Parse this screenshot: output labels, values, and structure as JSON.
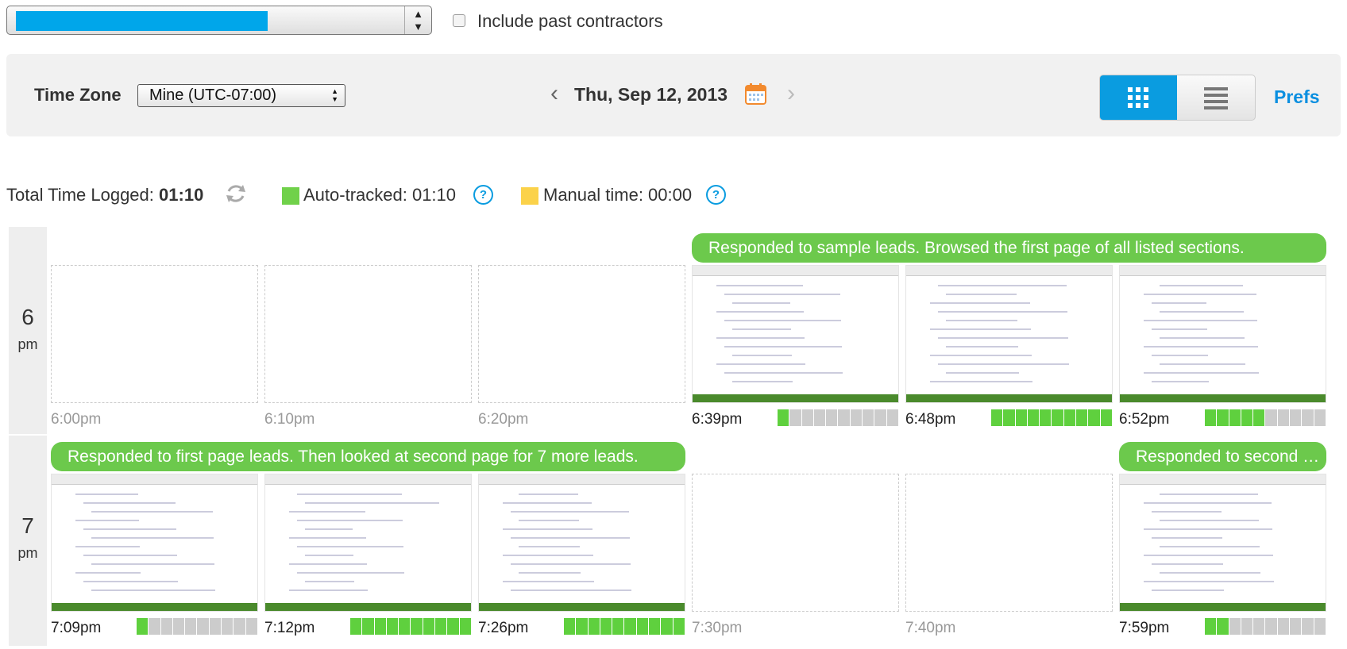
{
  "filter": {
    "past_contractors_label": "Include past contractors",
    "past_contractors_checked": false
  },
  "controls": {
    "timezone_label": "Time Zone",
    "timezone_value": "Mine (UTC-07:00)",
    "date": "Thu, Sep 12, 2013",
    "prefs_label": "Prefs",
    "active_view": "grid"
  },
  "totals": {
    "total_label": "Total Time Logged:",
    "total_value": "01:10",
    "auto_label": "Auto-tracked: 01:10",
    "manual_label": "Manual time: 00:00",
    "help_glyph": "?"
  },
  "colors": {
    "accent": "#0a9ce0",
    "auto": "#70d14a",
    "manual": "#fbd24a",
    "memo": "#6cc94c"
  },
  "hours": [
    {
      "hour": "6",
      "ampm": "pm",
      "memos": [
        {
          "text": "Responded to sample leads. Browsed the first page of all listed sections.",
          "start": 3,
          "span": 3
        }
      ],
      "slots": [
        {
          "time": "6:00pm",
          "filled": false
        },
        {
          "time": "6:10pm",
          "filled": false
        },
        {
          "time": "6:20pm",
          "filled": false
        },
        {
          "time": "6:39pm",
          "filled": true,
          "activity": 0.1
        },
        {
          "time": "6:48pm",
          "filled": true,
          "activity": 1.0
        },
        {
          "time": "6:52pm",
          "filled": true,
          "activity": 0.5
        }
      ]
    },
    {
      "hour": "7",
      "ampm": "pm",
      "memos": [
        {
          "text": "Responded to first page leads. Then looked at second page for 7 more leads.",
          "start": 0,
          "span": 3
        },
        {
          "text": "Responded to second page leads.",
          "start": 5,
          "span": 1
        }
      ],
      "slots": [
        {
          "time": "7:09pm",
          "filled": true,
          "activity": 0.1
        },
        {
          "time": "7:12pm",
          "filled": true,
          "activity": 1.0
        },
        {
          "time": "7:26pm",
          "filled": true,
          "activity": 1.0
        },
        {
          "time": "7:30pm",
          "filled": false
        },
        {
          "time": "7:40pm",
          "filled": false
        },
        {
          "time": "7:59pm",
          "filled": true,
          "activity": 0.2
        }
      ]
    }
  ]
}
